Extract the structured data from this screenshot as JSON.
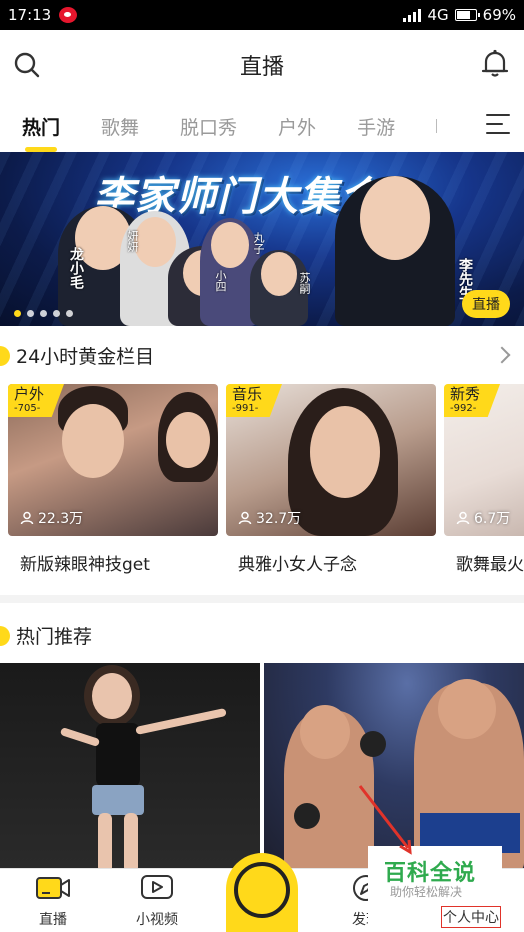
{
  "status_bar": {
    "time": "17:13",
    "network": "4G",
    "battery": "69%"
  },
  "header": {
    "title": "直播",
    "search_icon": "search-icon",
    "notification_icon": "bell-icon"
  },
  "tabs": [
    {
      "label": "热门",
      "active": true
    },
    {
      "label": "歌舞",
      "active": false
    },
    {
      "label": "脱口秀",
      "active": false
    },
    {
      "label": "户外",
      "active": false
    },
    {
      "label": "手游",
      "active": false
    }
  ],
  "banner": {
    "headline": "李家师门大集合",
    "names": [
      "龙小毛",
      "妍妍",
      "小四",
      "丸子",
      "苏嗣",
      "李先生"
    ],
    "badge": "直播",
    "slide_count": 5,
    "active_slide": 0
  },
  "golden_section": {
    "title": "24小时黄金栏目",
    "cards": [
      {
        "tag": "户外",
        "tag_number": "-705-",
        "viewers": "22.3万",
        "caption": "新版辣眼神技get"
      },
      {
        "tag": "音乐",
        "tag_number": "-991-",
        "viewers": "32.7万",
        "caption": "典雅小女人子念"
      },
      {
        "tag": "新秀",
        "tag_number": "-992-",
        "viewers": "6.7万",
        "caption": "歌舞最火"
      }
    ]
  },
  "hot_section": {
    "title": "热门推荐"
  },
  "tab_bar": {
    "items": [
      {
        "label": "直播",
        "icon": "camera-icon"
      },
      {
        "label": "小视频",
        "icon": "video-play-icon"
      },
      {
        "label": "发现",
        "icon": "discover-icon"
      },
      {
        "label": "个人中心",
        "icon": "profile-icon"
      }
    ]
  },
  "watermark": {
    "title": "百科全说",
    "subtitle": "助你轻松解决"
  },
  "colors": {
    "accent": "#ffd91a",
    "watermark_green": "#2faa4e",
    "highlight_red": "#e0332a"
  }
}
